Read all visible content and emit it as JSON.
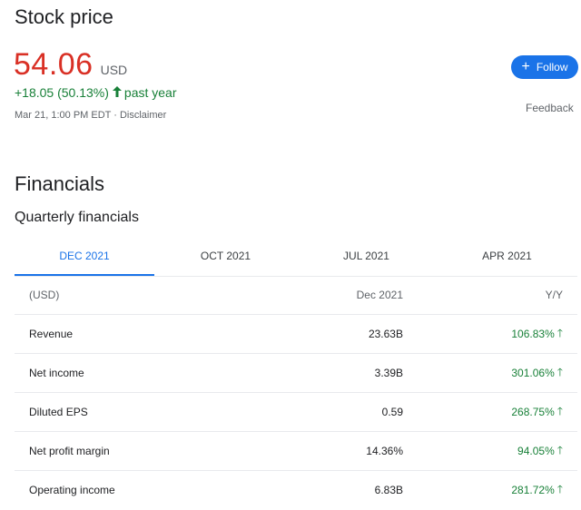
{
  "stock": {
    "title": "Stock price",
    "price": "54.06",
    "currency": "USD",
    "change": "+18.05 (50.13%)",
    "change_direction_icon": "arrow-up-icon",
    "period": "past year",
    "timestamp": "Mar 21, 1:00 PM EDT",
    "separator": "·",
    "disclaimer": "Disclaimer",
    "follow_label": "Follow",
    "feedback_label": "Feedback",
    "colors": {
      "price": "#d93025",
      "positive": "#188038",
      "accent": "#1a73e8"
    }
  },
  "financials": {
    "title": "Financials",
    "subtitle": "Quarterly financials",
    "tabs": [
      {
        "label": "DEC 2021",
        "active": true
      },
      {
        "label": "OCT 2021",
        "active": false
      },
      {
        "label": "JUL 2021",
        "active": false
      },
      {
        "label": "APR 2021",
        "active": false
      }
    ],
    "table": {
      "header": {
        "unit": "(USD)",
        "period": "Dec 2021",
        "change": "Y/Y"
      },
      "rows": [
        {
          "label": "Revenue",
          "value": "23.63B",
          "change": "106.83%"
        },
        {
          "label": "Net income",
          "value": "3.39B",
          "change": "301.06%"
        },
        {
          "label": "Diluted EPS",
          "value": "0.59",
          "change": "268.75%"
        },
        {
          "label": "Net profit margin",
          "value": "14.36%",
          "change": "94.05%"
        },
        {
          "label": "Operating income",
          "value": "6.83B",
          "change": "281.72%"
        }
      ]
    }
  }
}
